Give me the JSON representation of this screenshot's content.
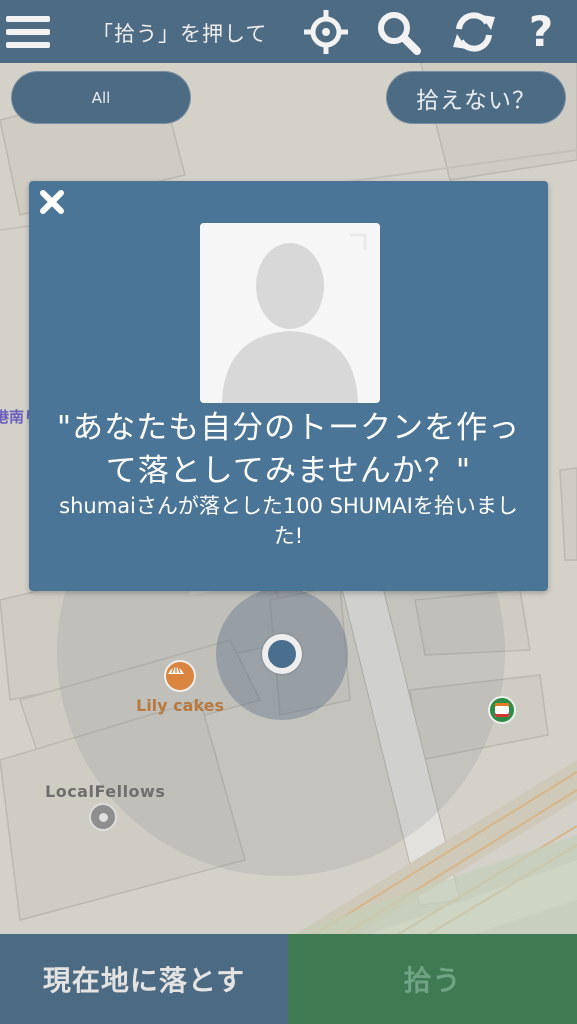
{
  "header": {
    "title": "「拾う」を押して",
    "icons": [
      "menu-icon",
      "locate-icon",
      "search-icon",
      "refresh-icon",
      "help-icon"
    ],
    "help_glyph": "?",
    "background": "#4e6b84"
  },
  "filters": {
    "all_label": "All",
    "cant_pick_label": "拾えない？"
  },
  "map": {
    "places": [
      {
        "name": "Lily cakes",
        "icon": "bakery-icon"
      },
      {
        "name": "LocalFellows",
        "icon": "place-icon"
      },
      {
        "name": "",
        "icon": "convenience-store-icon"
      }
    ],
    "edge_label": "港南り"
  },
  "modal": {
    "message": "\"あなたも自分のトークンを作って落としてみませんか？\"",
    "sub_message": "shumaiさんが落とした100 SHUMAIを拾いました!",
    "background": "#4b7597"
  },
  "bottom": {
    "drop_label": "現在地に落とす",
    "pick_label": "拾う",
    "drop_color": "#4c6a82",
    "pick_color": "#3f7a52"
  }
}
